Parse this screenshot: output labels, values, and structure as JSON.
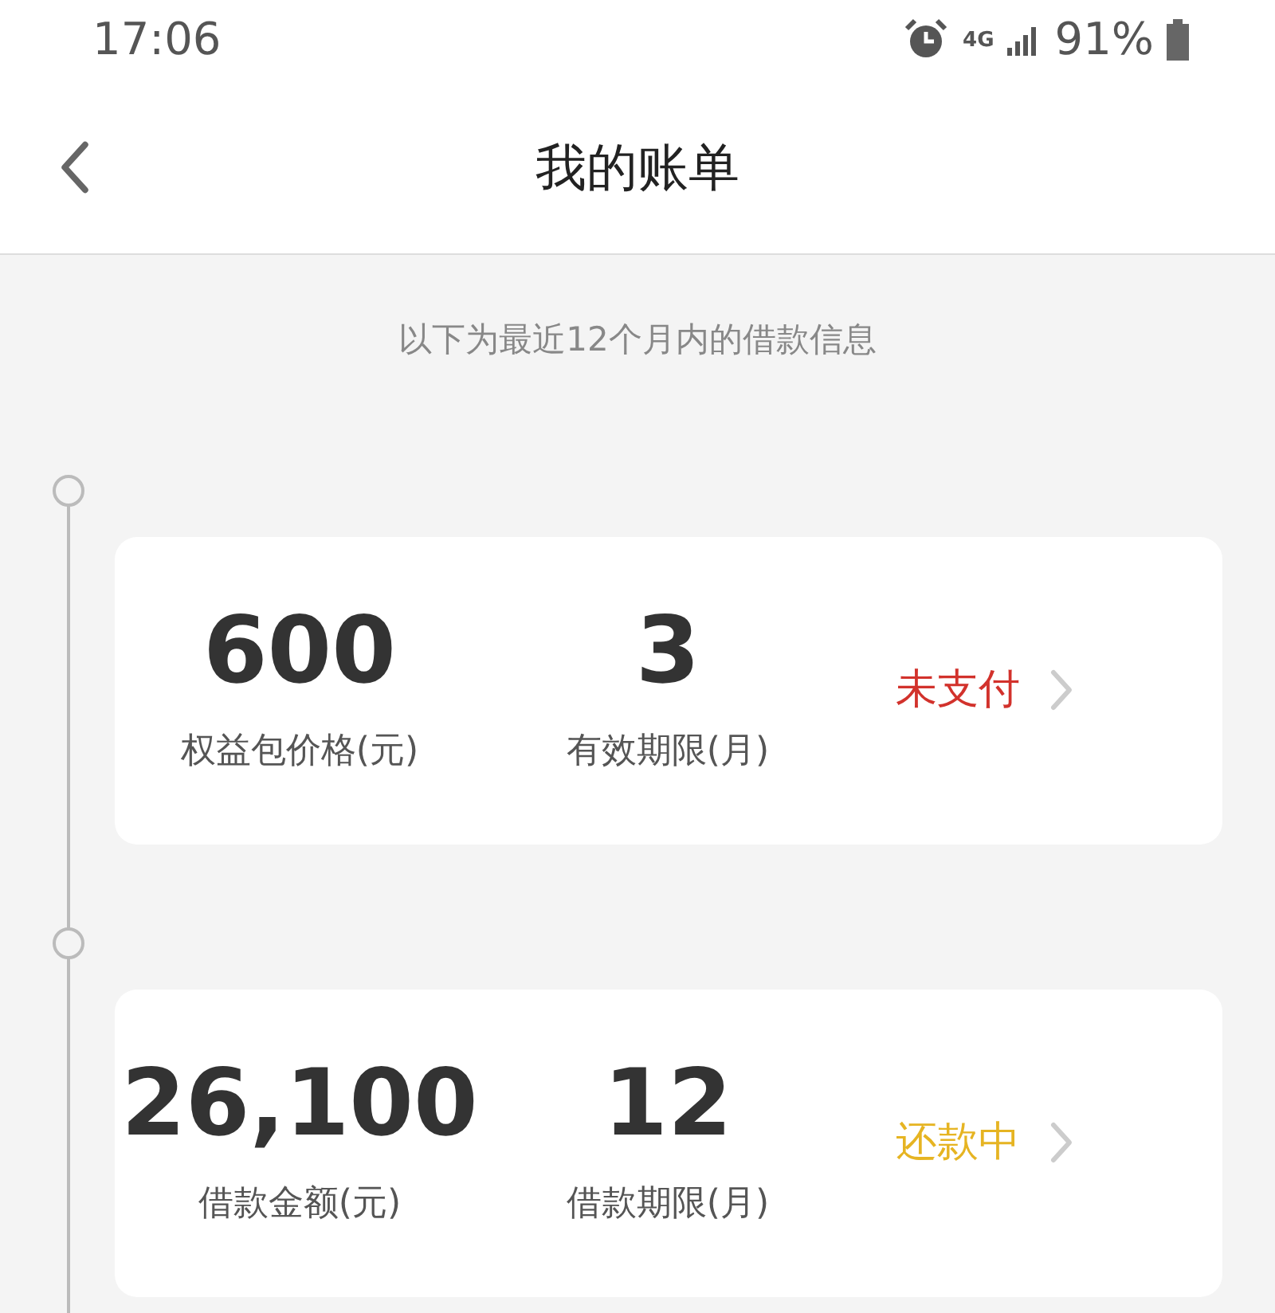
{
  "status_bar": {
    "time": "17:06",
    "network": "4G",
    "battery": "91%"
  },
  "header": {
    "title": "我的账单"
  },
  "subtitle": "以下为最近12个月内的借款信息",
  "bills": [
    {
      "values": [
        {
          "value": "600",
          "label": "权益包价格(元)"
        },
        {
          "value": "3",
          "label": "有效期限(月)"
        }
      ],
      "status": "未支付",
      "color": "#d2322c"
    },
    {
      "values": [
        {
          "value": "26,100",
          "label": "借款金额(元)"
        },
        {
          "value": "12",
          "label": "借款期限(月)"
        }
      ],
      "status": "还款中",
      "color": "#e6b422"
    }
  ]
}
